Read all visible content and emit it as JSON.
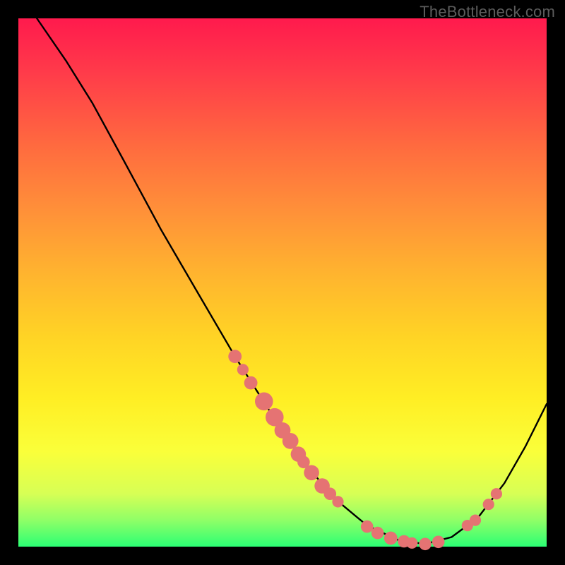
{
  "watermark": "TheBottleneck.com",
  "colors": {
    "background": "#000000",
    "curve_stroke": "#000000",
    "marker_fill": "#e57373",
    "gradient_top": "#ff1a4d",
    "gradient_bottom": "#2bff74"
  },
  "chart_data": {
    "type": "line",
    "title": "",
    "xlabel": "",
    "ylabel": "",
    "xlim": [
      0,
      100
    ],
    "ylim": [
      0,
      100
    ],
    "curve": [
      {
        "x": 3.5,
        "y": 100
      },
      {
        "x": 9,
        "y": 92
      },
      {
        "x": 14,
        "y": 84
      },
      {
        "x": 20,
        "y": 73
      },
      {
        "x": 27,
        "y": 60
      },
      {
        "x": 34,
        "y": 48
      },
      {
        "x": 41,
        "y": 36
      },
      {
        "x": 48,
        "y": 25
      },
      {
        "x": 54,
        "y": 16
      },
      {
        "x": 60,
        "y": 9
      },
      {
        "x": 66,
        "y": 4
      },
      {
        "x": 72,
        "y": 1.2
      },
      {
        "x": 77,
        "y": 0.5
      },
      {
        "x": 82,
        "y": 1.8
      },
      {
        "x": 87,
        "y": 5.5
      },
      {
        "x": 92,
        "y": 12
      },
      {
        "x": 96,
        "y": 19
      },
      {
        "x": 100,
        "y": 27
      }
    ],
    "markers": [
      {
        "x": 41,
        "y": 36,
        "r": 1.4
      },
      {
        "x": 42.5,
        "y": 33.5,
        "r": 1.2
      },
      {
        "x": 44,
        "y": 31,
        "r": 1.4
      },
      {
        "x": 46.5,
        "y": 27.5,
        "r": 1.9
      },
      {
        "x": 48.5,
        "y": 24.5,
        "r": 1.9
      },
      {
        "x": 50,
        "y": 22,
        "r": 1.7
      },
      {
        "x": 51.5,
        "y": 20,
        "r": 1.7
      },
      {
        "x": 53,
        "y": 17.5,
        "r": 1.6
      },
      {
        "x": 54,
        "y": 16,
        "r": 1.3
      },
      {
        "x": 55.5,
        "y": 14,
        "r": 1.6
      },
      {
        "x": 57.5,
        "y": 11.5,
        "r": 1.6
      },
      {
        "x": 59,
        "y": 10,
        "r": 1.3
      },
      {
        "x": 60.5,
        "y": 8.5,
        "r": 1.2
      },
      {
        "x": 66,
        "y": 3.8,
        "r": 1.3
      },
      {
        "x": 68,
        "y": 2.6,
        "r": 1.3
      },
      {
        "x": 70.5,
        "y": 1.6,
        "r": 1.4
      },
      {
        "x": 73,
        "y": 1.0,
        "r": 1.3
      },
      {
        "x": 74.5,
        "y": 0.7,
        "r": 1.2
      },
      {
        "x": 77,
        "y": 0.5,
        "r": 1.3
      },
      {
        "x": 79.5,
        "y": 0.9,
        "r": 1.3
      },
      {
        "x": 85,
        "y": 4.0,
        "r": 1.2
      },
      {
        "x": 86.5,
        "y": 5.0,
        "r": 1.2
      },
      {
        "x": 89,
        "y": 8.0,
        "r": 1.2
      },
      {
        "x": 90.5,
        "y": 10.0,
        "r": 1.2
      }
    ]
  }
}
